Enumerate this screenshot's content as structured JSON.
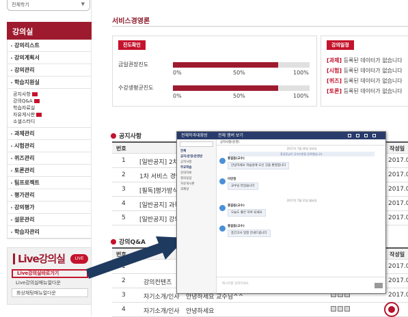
{
  "sidebar": {
    "select_value": "전체학기",
    "menu_title": "강의실",
    "items": [
      "강의리스트",
      "강의계획서",
      "강의관리",
      "학습지원실"
    ],
    "sub_items": [
      "공지사항",
      "강의Q&A",
      "학습자료실",
      "자유게시판",
      "소셜스터디"
    ],
    "items2": [
      "과제관리",
      "시험관리",
      "퀴즈관리",
      "토론관리",
      "팀프로젝트",
      "평가관리",
      "강의평가",
      "설문관리",
      "학습자관리"
    ],
    "live": {
      "title": "Live강의실",
      "badge": "LIVE",
      "links": [
        "Live강의실바로가기",
        "Live강의실매뉴얼다운",
        "화상채팅매뉴얼다운"
      ]
    }
  },
  "page": {
    "title": "서비스경영론"
  },
  "progress": {
    "tab": "진도확인",
    "rows": [
      {
        "label": "금일권장진도",
        "value": 0.77
      },
      {
        "label": "수강생평균진도",
        "value": 0.77
      }
    ],
    "ticks": [
      "0%",
      "50%",
      "100%"
    ]
  },
  "schedule": {
    "tab": "강의일정",
    "items": [
      {
        "tag": "[과제]",
        "text": "등록된 데이터가 없습니다"
      },
      {
        "tag": "[시험]",
        "text": "등록된 데이터가 없습니다"
      },
      {
        "tag": "[퀴즈]",
        "text": "등록된 데이터가 없습니다"
      },
      {
        "tag": "[토론]",
        "text": "등록된 데이터가 없습니다"
      }
    ]
  },
  "notice": {
    "title": "공지사항",
    "headers": {
      "no": "번호",
      "date": "작성일"
    },
    "rows": [
      {
        "no": "1",
        "title": "[일반공지] 2차 라",
        "date": "2017.07."
      },
      {
        "no": "2",
        "title": "1차 서비스 경영론",
        "date": "2017.06."
      },
      {
        "no": "3",
        "title": "[필독]평가방식 안",
        "date": "2017.06."
      },
      {
        "no": "4",
        "title": "[일반공지] 과목 안",
        "date": "2017.06."
      },
      {
        "no": "5",
        "title": "[일반공지] 강의유",
        "date": "2017.06."
      }
    ]
  },
  "qna": {
    "title": "강의Q&A",
    "headers": {
      "no": "번호",
      "date": "작성일"
    },
    "rows": [
      {
        "no": "1",
        "cat": "",
        "title": "",
        "date": "2017.07."
      },
      {
        "no": "2",
        "cat": "강의컨텐츠",
        "title": "",
        "date": "2017.06."
      },
      {
        "no": "3",
        "cat": "자기소개/인사",
        "title": "안녕하세요 교수님^^",
        "date": "2017.06."
      },
      {
        "no": "4",
        "cat": "자기소개/인사",
        "title": "안녕하세요",
        "date": ""
      }
    ]
  },
  "overlay": {
    "app_title": "전체학과대화방",
    "tab": "전체 멤버 보기",
    "left_items": [
      "전체",
      "공지/운영/운영방",
      "공지사항",
      "주요학습",
      "강의자료",
      "질의응답",
      "자유게시판",
      "과제방"
    ],
    "channel": "공지사항(운영)",
    "date1": "2017년 7월 30일 일요일",
    "date2": "2017년 7월 31일 월요일",
    "system": "홍길동님이 공지사항을 등록했습니다.",
    "messages": [
      {
        "name": "홍길동(교수)",
        "text": "안녕하세요 학습방에 오신 것을 환영합니다"
      },
      {
        "name": "이민정",
        "text": "교수님 반갑습니다"
      },
      {
        "name": "홍길동(교수)",
        "text": "오늘도 좋은 하루 되세요"
      },
      {
        "name": "홍길동(교수)",
        "text": "중간고사 일정 안내드립니다"
      }
    ],
    "input_placeholder": "메시지를 입력하세요",
    "send": "전송"
  }
}
